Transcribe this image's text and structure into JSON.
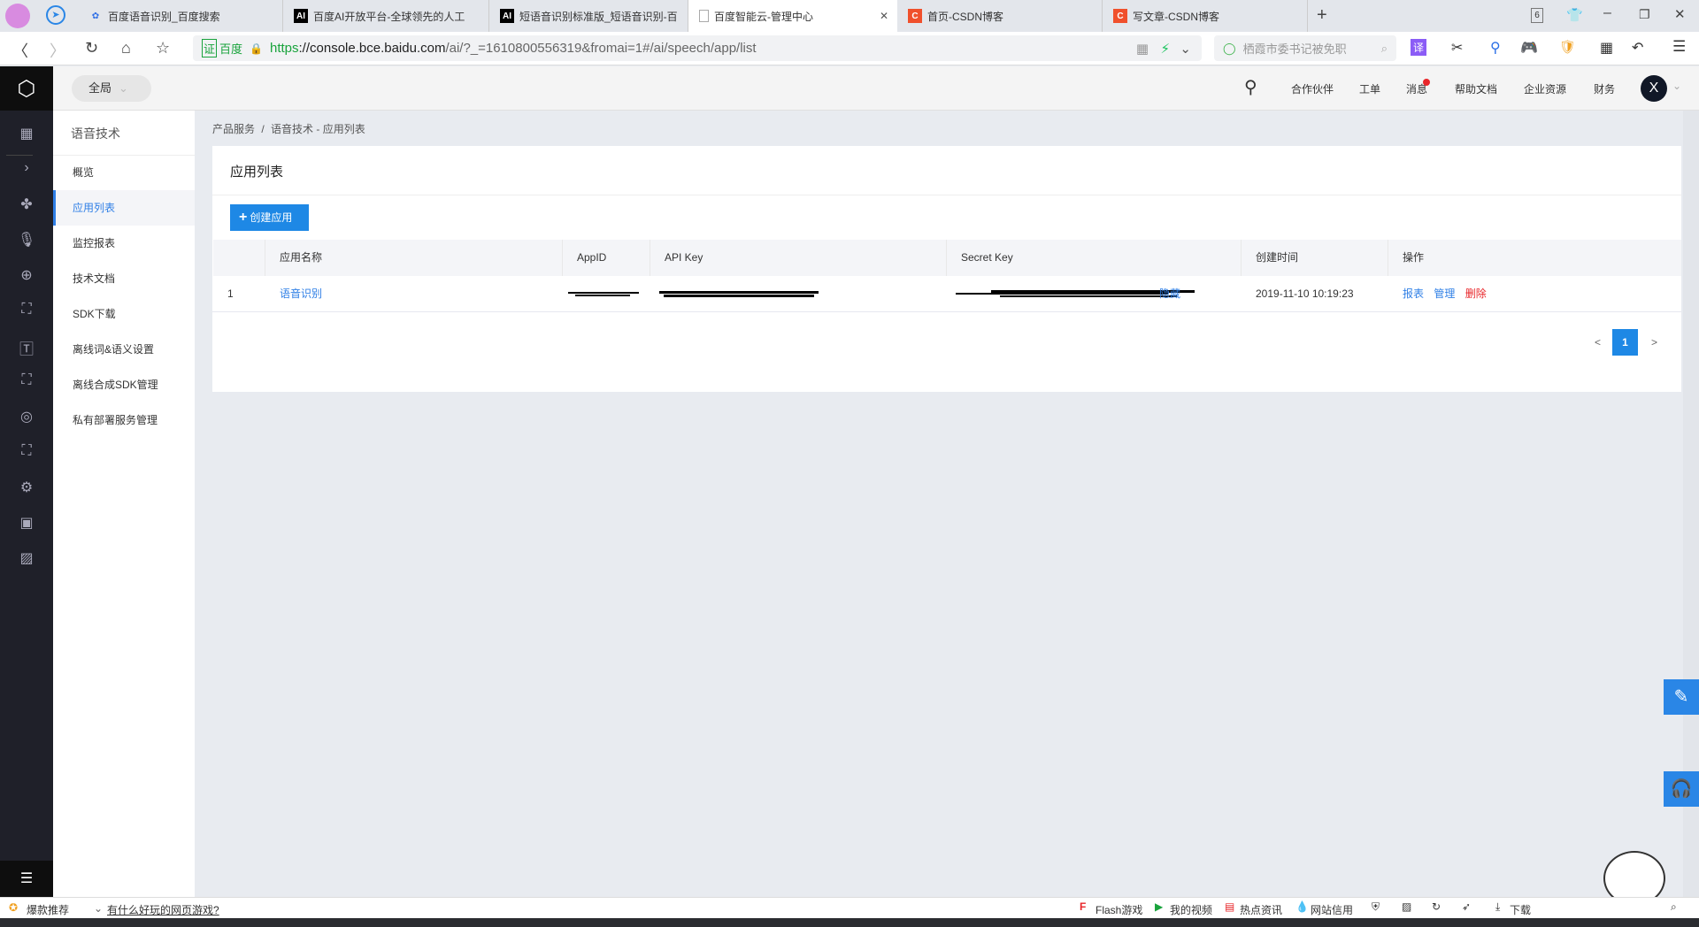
{
  "browser": {
    "tabs": [
      {
        "label": "百度语音识别_百度搜索",
        "icon": "baidu-paw-icon"
      },
      {
        "label": "百度AI开放平台-全球领先的人工",
        "icon": "ai-icon"
      },
      {
        "label": "短语音识别标准版_短语音识别-百",
        "icon": "ai-icon"
      },
      {
        "label": "百度智能云-管理中心",
        "icon": "page-icon"
      },
      {
        "label": "首页-CSDN博客",
        "icon": "csdn-icon"
      },
      {
        "label": "写文章-CSDN博客",
        "icon": "csdn-icon"
      }
    ],
    "tab_count": "6",
    "cert_label": "百度",
    "url_scheme": "https",
    "url_host": "://console.bce.baidu.com",
    "url_path": "/ai/?_=1610800556319&fromai=1#/ai/speech/app/list",
    "search_placeholder": "栖霞市委书记被免职",
    "translate_label": "译"
  },
  "header": {
    "scope": "全局",
    "links": [
      "合作伙伴",
      "工单",
      "消息",
      "帮助文档",
      "企业资源",
      "财务"
    ],
    "avatar": "X",
    "accent": "#2f7fe6"
  },
  "sidebar": {
    "title": "语音技术",
    "items": [
      "概览",
      "应用列表",
      "监控报表",
      "技术文档",
      "SDK下载",
      "离线词&语义设置",
      "离线合成SDK管理",
      "私有部署服务管理"
    ],
    "active": 1
  },
  "breadcrumb": {
    "root": "产品服务",
    "sep": "/",
    "current": "语音技术 - 应用列表"
  },
  "page": {
    "title": "应用列表",
    "create_button": "创建应用",
    "columns": [
      "",
      "应用名称",
      "AppID",
      "API Key",
      "Secret Key",
      "创建时间",
      "操作"
    ],
    "rows": [
      {
        "index": "1",
        "name": "语音识别",
        "secret_toggle": "隐藏",
        "created": "2019-11-10 10:19:23",
        "actions": [
          "报表",
          "管理",
          "删除"
        ]
      }
    ],
    "pagination": {
      "prev": "<",
      "current": "1",
      "next": ">"
    }
  },
  "statusbar": {
    "left": [
      "爆款推荐",
      "有什么好玩的网页游戏?"
    ],
    "right": [
      "Flash游戏",
      "我的视频",
      "热点资讯",
      "网站信用",
      "下载"
    ]
  }
}
